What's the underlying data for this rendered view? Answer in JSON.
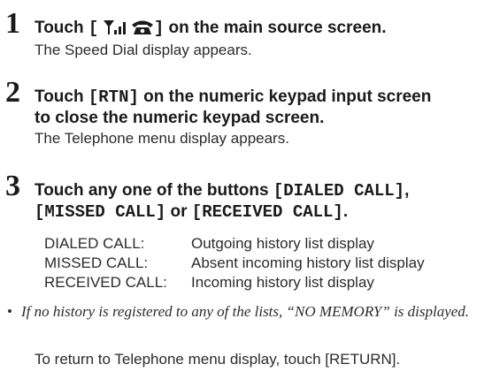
{
  "steps": [
    {
      "number": "1",
      "heading_before": "Touch ",
      "bracket_open": "[",
      "bracket_close": "]",
      "heading_after": " on the main source screen.",
      "description": "The Speed Dial display appears.",
      "icons": [
        "signal-bars-icon",
        "telephone-icon"
      ]
    },
    {
      "number": "2",
      "heading_before": "Touch ",
      "key": "[RTN]",
      "heading_after": " on the numeric keypad input screen",
      "heading_line2": "to close the numeric keypad screen.",
      "description": "The Telephone menu display appears."
    },
    {
      "number": "3",
      "heading_line1_before": "Touch any one of the buttons ",
      "key1": "[DIALED CALL]",
      "heading_line1_after": ",",
      "key2": "[MISSED CALL]",
      "heading_line2_mid": " or ",
      "key3": "[RECEIVED CALL]",
      "heading_line2_after": ".",
      "definitions": [
        {
          "term": "DIALED CALL:",
          "meaning": "Outgoing history list display"
        },
        {
          "term": "MISSED CALL:",
          "meaning": "Absent incoming history list display"
        },
        {
          "term": "RECEIVED CALL:",
          "meaning": "Incoming history list display"
        }
      ]
    }
  ],
  "note": {
    "bullet": "•",
    "text": "If no history is registered to any of the lists, “NO MEMORY” is displayed."
  },
  "return_text": "To return to Telephone menu display, touch [RETURN]."
}
